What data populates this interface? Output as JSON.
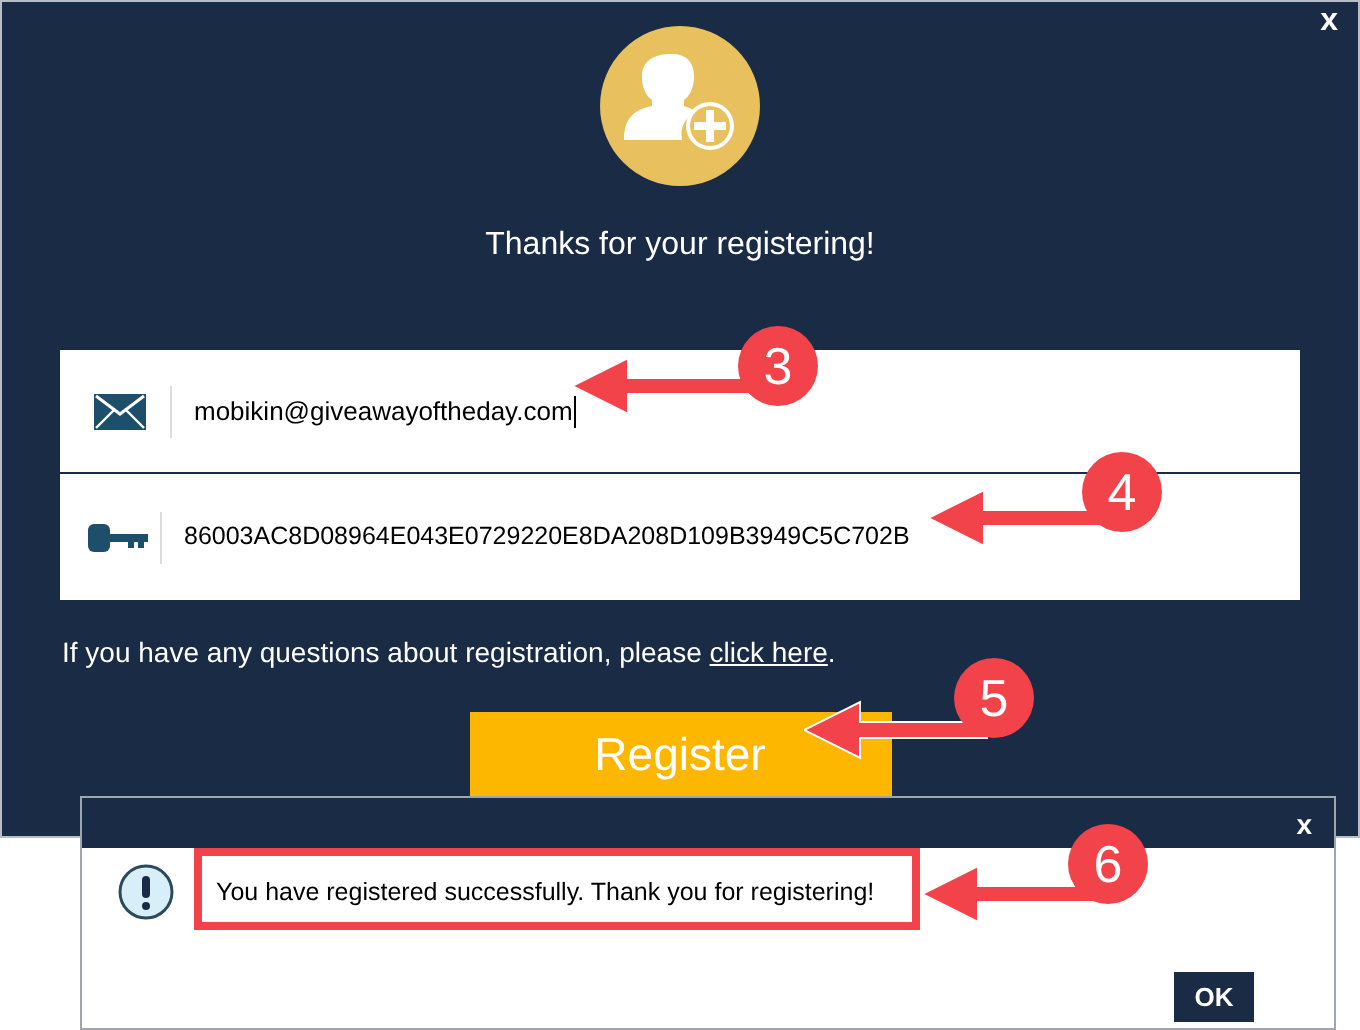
{
  "registration_window": {
    "close": "x",
    "heading": "Thanks for your registering!",
    "email_field": {
      "value": "mobikin@giveawayoftheday.com"
    },
    "key_field": {
      "value": "86003AC8D08964E043E0729220E8DA208D109B3949C5C702B"
    },
    "help_text": "If you have any questions about registration, please ",
    "help_link": "click here",
    "help_end": ".",
    "register_button": "Register"
  },
  "message_box": {
    "close": "x",
    "message": "You have registered successfully. Thank you for registering!",
    "ok_button": "OK"
  },
  "annotations": [
    {
      "number": "3"
    },
    {
      "number": "4"
    },
    {
      "number": "5"
    },
    {
      "number": "6"
    }
  ]
}
